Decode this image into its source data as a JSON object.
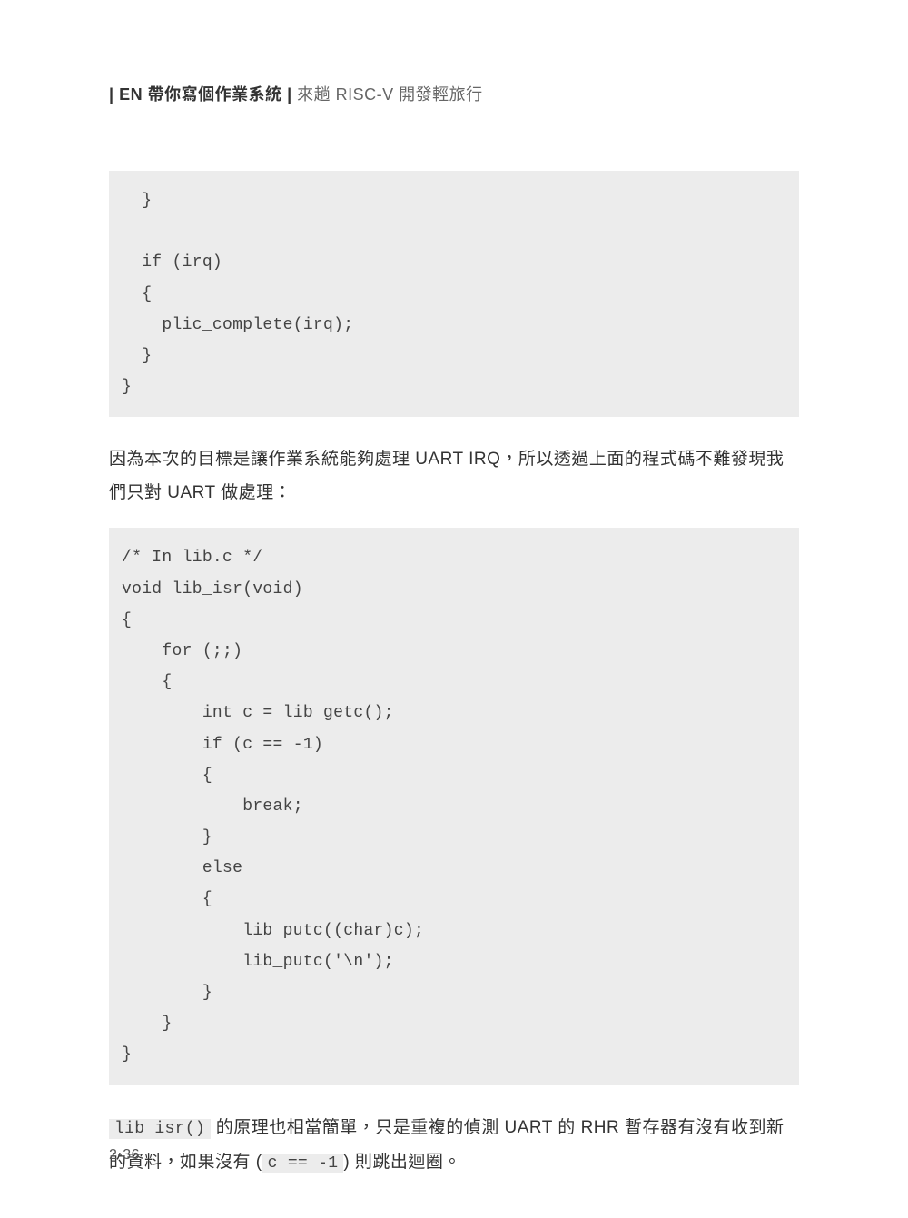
{
  "header": {
    "bar": "|",
    "bold": "EN 帶你寫個作業系統",
    "sep": "|",
    "light": "來趟 RISC-V 開發輕旅行"
  },
  "code1": "  }\n\n  if (irq)\n  {\n    plic_complete(irq);\n  }\n}",
  "para1": "因為本次的目標是讓作業系統能夠處理 UART IRQ，所以透過上面的程式碼不難發現我們只對 UART 做處理：",
  "code2": "/* In lib.c */\nvoid lib_isr(void)\n{\n    for (;;)\n    {\n        int c = lib_getc();\n        if (c == -1)\n        {\n            break;\n        }\n        else\n        {\n            lib_putc((char)c);\n            lib_putc('\\n');\n        }\n    }\n}",
  "para2": {
    "inline1": "lib_isr()",
    "t1": " 的原理也相當簡單，只是重複的偵測 UART 的 RHR 暫存器有沒有收到新的資料，如果沒有 (",
    "inline2": "c == -1",
    "t2": ") 則跳出迴圈。"
  },
  "pageNum": "2-36"
}
